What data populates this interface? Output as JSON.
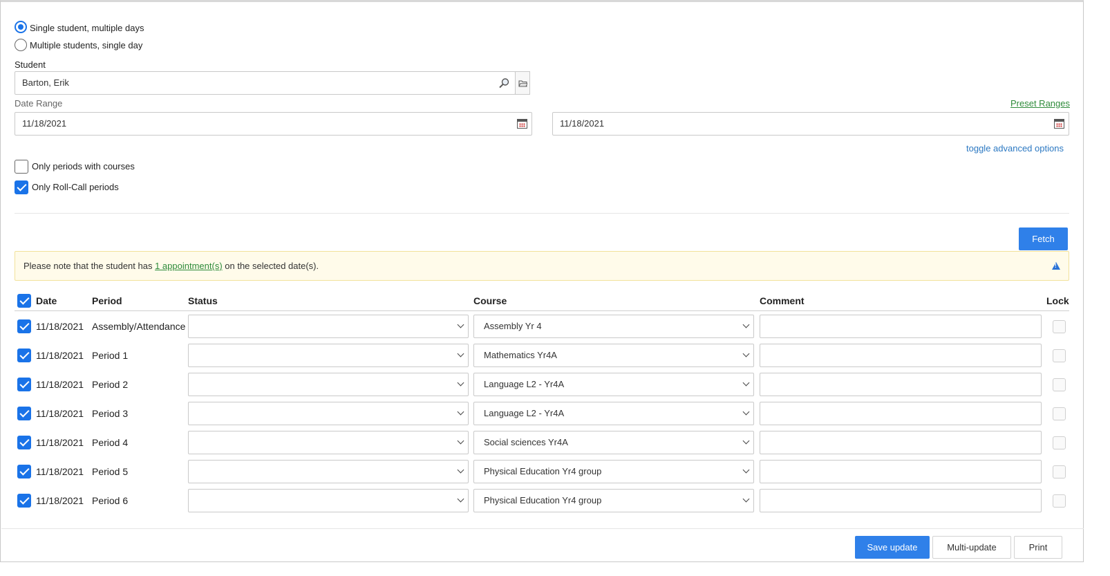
{
  "mode": {
    "option_single": "Single student, multiple days",
    "option_multiple": "Multiple students, single day",
    "selected": "single"
  },
  "student": {
    "label": "Student",
    "value": "Barton, Erik"
  },
  "date_range": {
    "label": "Date Range",
    "preset_link": "Preset Ranges",
    "start": "11/18/2021",
    "end": "11/18/2021",
    "toggle_link": "toggle advanced options"
  },
  "filters": {
    "only_periods_with_courses": {
      "label": "Only periods with courses",
      "checked": false
    },
    "only_roll_call": {
      "label": "Only Roll-Call periods",
      "checked": true
    }
  },
  "fetch_label": "Fetch",
  "alert": {
    "prefix": "Please note that the student has ",
    "link": "1 appointment(s)",
    "suffix": " on the selected date(s)."
  },
  "table": {
    "headers": {
      "date": "Date",
      "period": "Period",
      "status": "Status",
      "course": "Course",
      "comment": "Comment",
      "lock": "Lock"
    },
    "rows": [
      {
        "date": "11/18/2021",
        "period": "Assembly/Attendance",
        "status": "",
        "course": "Assembly Yr 4",
        "comment": ""
      },
      {
        "date": "11/18/2021",
        "period": "Period 1",
        "status": "",
        "course": "Mathematics Yr4A",
        "comment": ""
      },
      {
        "date": "11/18/2021",
        "period": "Period 2",
        "status": "",
        "course": "Language L2 - Yr4A",
        "comment": ""
      },
      {
        "date": "11/18/2021",
        "period": "Period 3",
        "status": "",
        "course": "Language L2 - Yr4A",
        "comment": ""
      },
      {
        "date": "11/18/2021",
        "period": "Period 4",
        "status": "",
        "course": "Social sciences Yr4A",
        "comment": ""
      },
      {
        "date": "11/18/2021",
        "period": "Period 5",
        "status": "",
        "course": "Physical Education Yr4 group",
        "comment": ""
      },
      {
        "date": "11/18/2021",
        "period": "Period 6",
        "status": "",
        "course": "Physical Education Yr4 group",
        "comment": ""
      }
    ]
  },
  "footer": {
    "save": "Save update",
    "multi": "Multi-update",
    "print": "Print"
  },
  "icons": {
    "search": "search-icon",
    "folder": "folder-icon",
    "calendar": "calendar-icon",
    "warning": "warning-icon",
    "chevron": "chevron-down-icon"
  },
  "colors": {
    "primary": "#2f80e9",
    "link_green": "#2e8b3a",
    "link_blue": "#2b78c2",
    "alert_bg": "#fffbea"
  }
}
